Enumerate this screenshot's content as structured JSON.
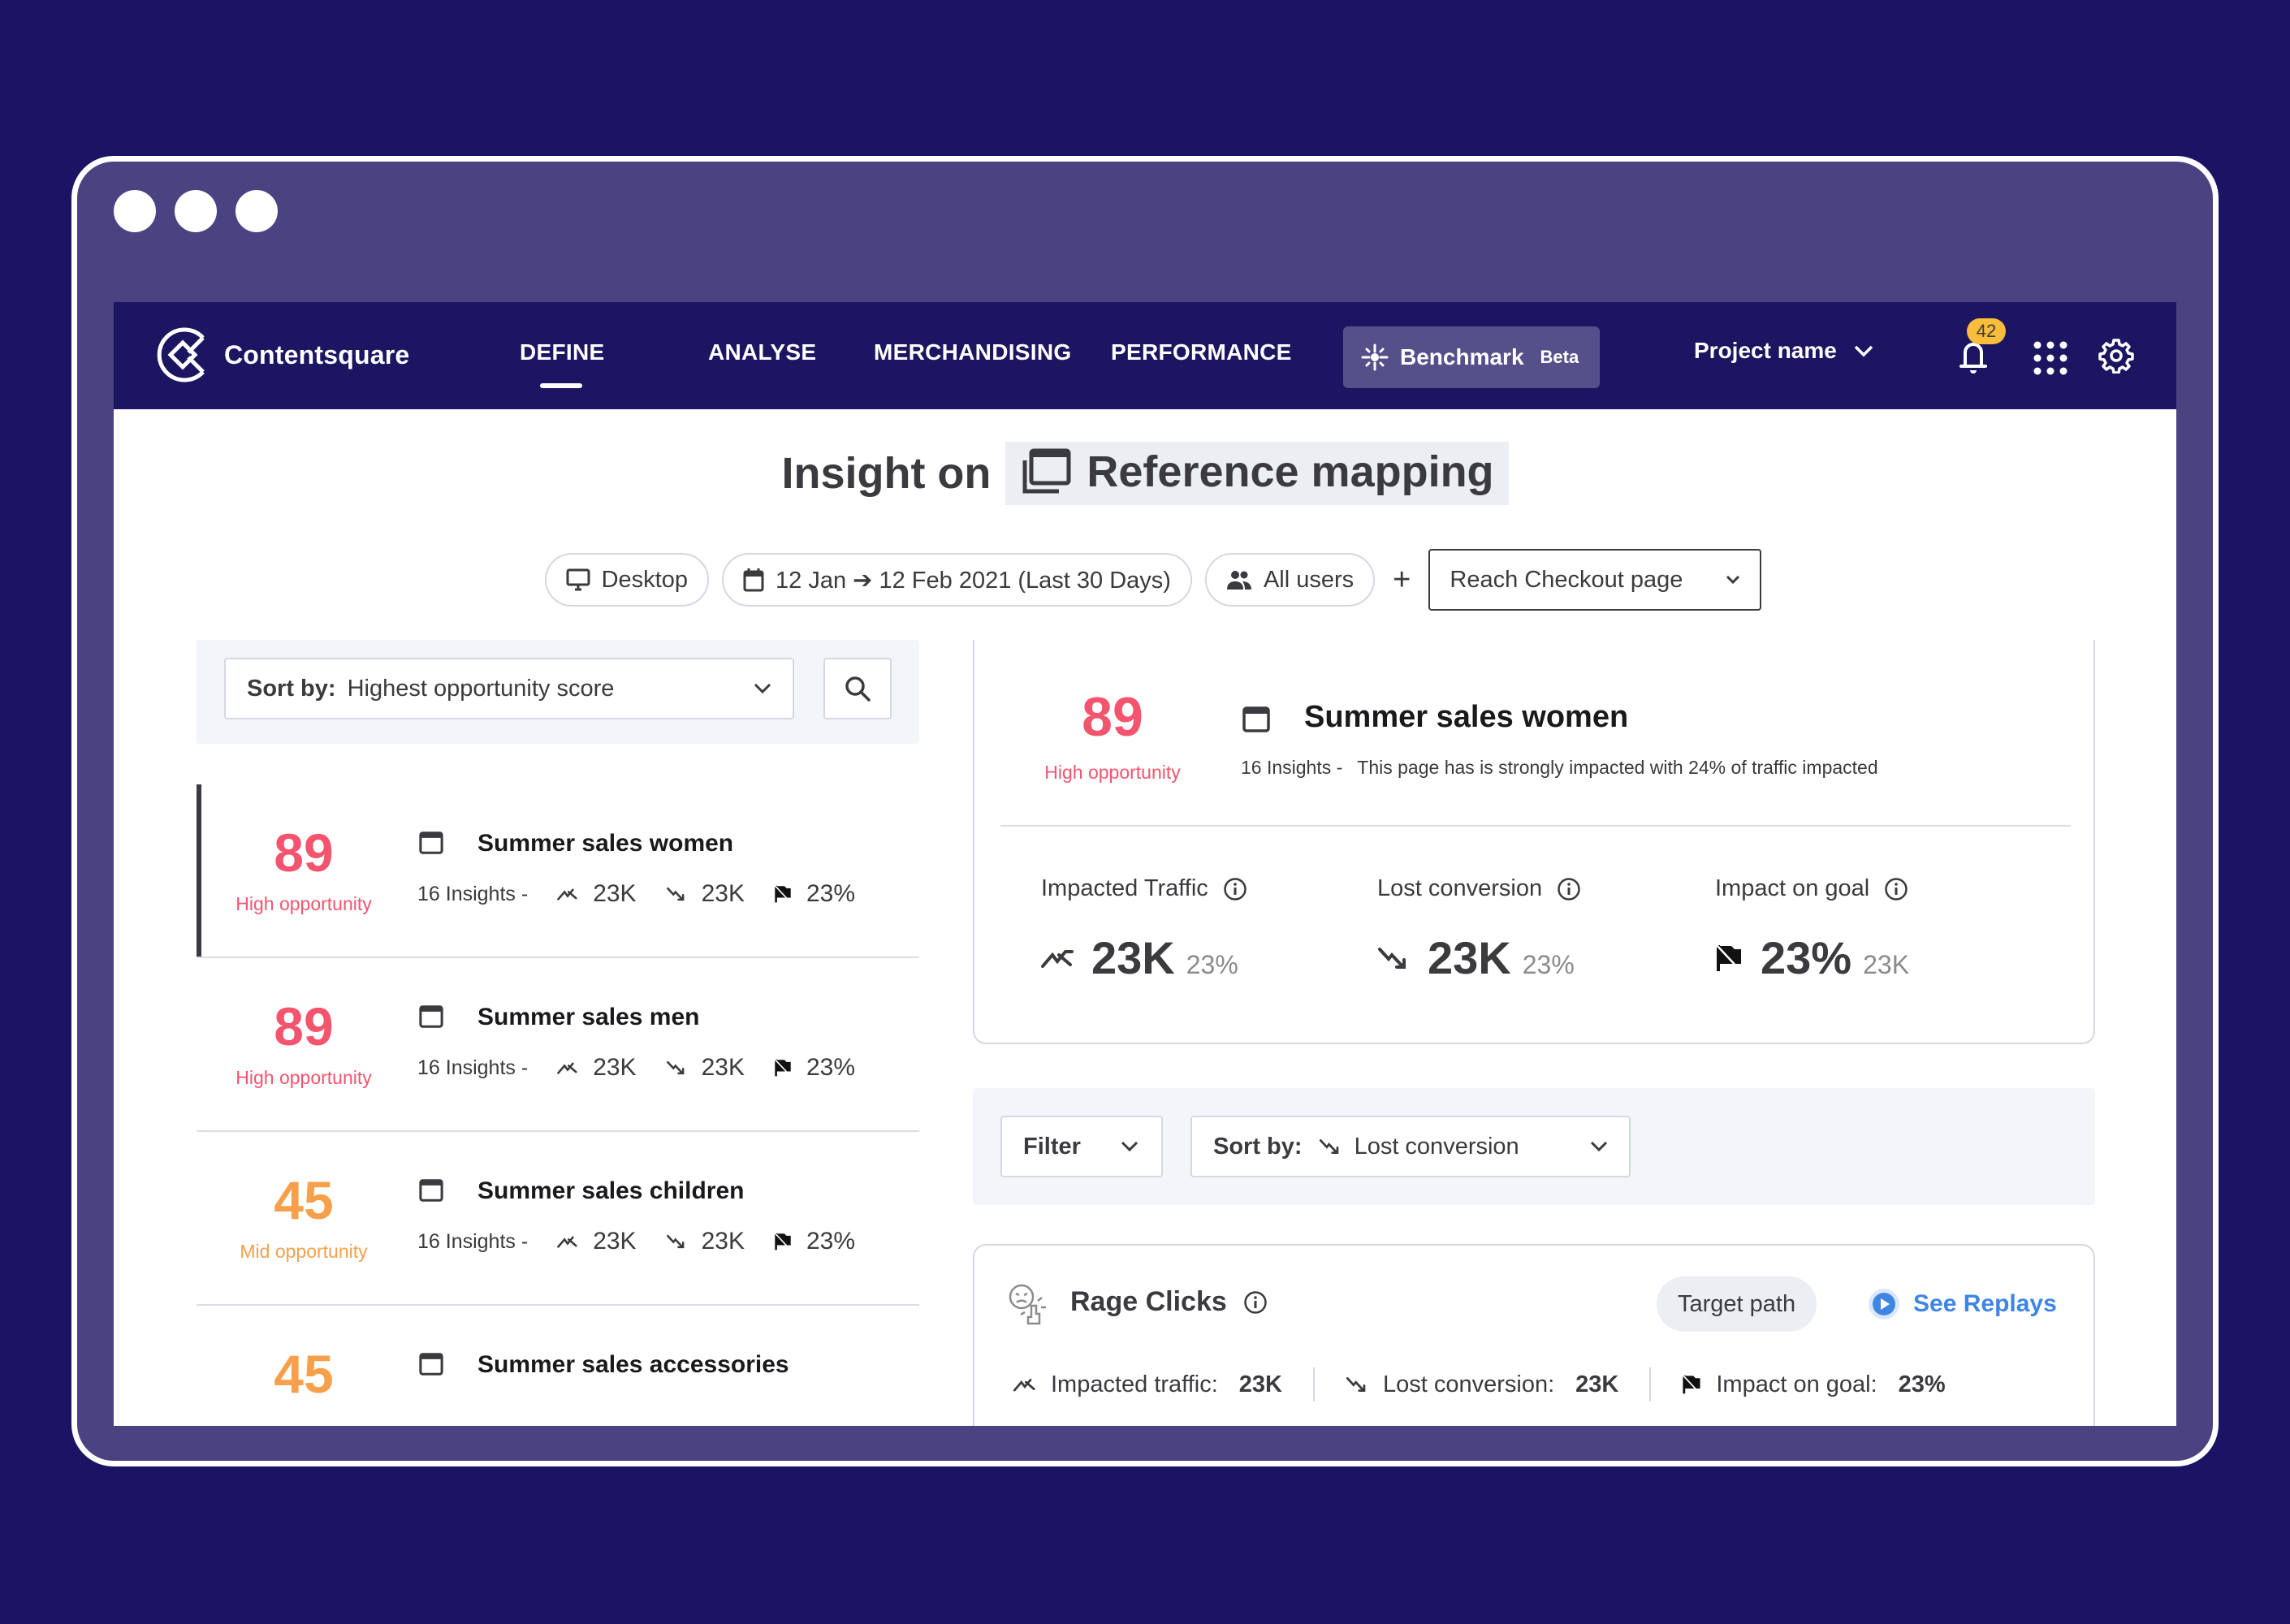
{
  "window": {
    "controls": [
      "dot",
      "dot",
      "dot"
    ]
  },
  "nav": {
    "brand": "Contentsquare",
    "items": [
      {
        "label": "DEFINE",
        "active": true
      },
      {
        "label": "ANALYSE",
        "active": false
      },
      {
        "label": "MERCHANDISING",
        "active": false
      },
      {
        "label": "PERFORMANCE",
        "active": false
      }
    ],
    "benchmark": {
      "label": "Benchmark",
      "tag": "Beta",
      "icon": "sparkle-icon"
    },
    "project": {
      "label": "Project name",
      "icon": "chevron-down-icon"
    },
    "notifications": {
      "count": "42",
      "icon": "bell-icon"
    },
    "apps_icon": "apps-grid-icon",
    "settings_icon": "gear-icon"
  },
  "header": {
    "prefix": "Insight on",
    "page_name": "Reference mapping",
    "page_icon": "pages-icon"
  },
  "filters": {
    "device": {
      "label": "Desktop",
      "icon": "desktop-icon"
    },
    "date": {
      "label": "12 Jan ➔ 12 Feb 2021 (Last 30 Days)",
      "icon": "calendar-icon"
    },
    "segment": {
      "label": "All users",
      "icon": "users-icon"
    },
    "add": "+",
    "goal": {
      "label": "Reach Checkout page",
      "icon": "chevron-down-icon"
    }
  },
  "list_toolbar": {
    "sort_label": "Sort by:",
    "sort_value": "Highest opportunity score",
    "search_icon": "search-icon"
  },
  "colors": {
    "high": "#f4546e",
    "mid": "#f7a04b",
    "link": "#3f86e4",
    "badge": "#f7bd3b",
    "nav_bg": "#1b1562"
  },
  "insights": [
    {
      "score": "89",
      "level": "High opportunity",
      "level_key": "high",
      "name": "Summer sales women",
      "insights": "16 Insights -",
      "traffic": "23K",
      "lost": "23K",
      "goal": "23%",
      "active": true
    },
    {
      "score": "89",
      "level": "High opportunity",
      "level_key": "high",
      "name": "Summer sales men",
      "insights": "16 Insights -",
      "traffic": "23K",
      "lost": "23K",
      "goal": "23%",
      "active": false
    },
    {
      "score": "45",
      "level": "Mid opportunity",
      "level_key": "mid",
      "name": "Summer sales children",
      "insights": "16 Insights -",
      "traffic": "23K",
      "lost": "23K",
      "goal": "23%",
      "active": false
    },
    {
      "score": "45",
      "level": "",
      "level_key": "mid",
      "name": "Summer sales accessories",
      "insights": "",
      "traffic": "",
      "lost": "",
      "goal": "",
      "active": false
    }
  ],
  "detail": {
    "score": "89",
    "level": "High opportunity",
    "name": "Summer sales women",
    "insights": "16 Insights -",
    "description": "This page has is strongly impacted with 24% of traffic impacted",
    "kpis": [
      {
        "label": "Impacted Traffic",
        "value": "23K",
        "secondary": "23%",
        "icon": "trend-traffic-icon"
      },
      {
        "label": "Lost conversion",
        "value": "23K",
        "secondary": "23%",
        "icon": "trend-down-icon"
      },
      {
        "label": "Impact on goal",
        "value": "23%",
        "secondary": "23K",
        "icon": "goal-flag-icon"
      }
    ]
  },
  "detail_toolbar": {
    "filter_label": "Filter",
    "sort_label": "Sort by:",
    "sort_value": "Lost conversion"
  },
  "rage_clicks": {
    "title": "Rage Clicks",
    "target_path": "Target path",
    "see_replays": "See Replays",
    "metrics": [
      {
        "label": "Impacted traffic:",
        "value": "23K"
      },
      {
        "label": "Lost conversion:",
        "value": "23K"
      },
      {
        "label": "Impact on goal:",
        "value": "23%"
      }
    ]
  }
}
